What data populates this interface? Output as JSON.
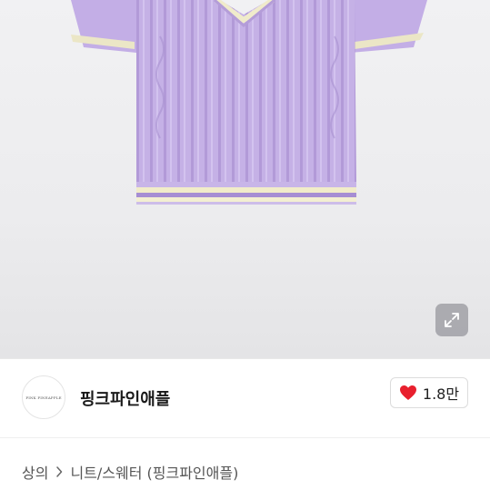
{
  "product_image": {
    "subject": "lavender cable-knit sweater vest",
    "colors": {
      "knit": "#c7b3e8",
      "stripe": "#f1ecc9"
    }
  },
  "expand_button": {
    "icon": "expand-arrows-icon"
  },
  "seller": {
    "avatar_text": "PINK PINEAPPLE",
    "name": "핑크파인애플"
  },
  "like": {
    "icon": "heart-icon",
    "color": "#e8202e",
    "count": "1.8만"
  },
  "breadcrumb": {
    "items": [
      "상의",
      "니트/스웨터 (핑크파인애플)"
    ],
    "separator_icon": "chevron-right-icon"
  }
}
